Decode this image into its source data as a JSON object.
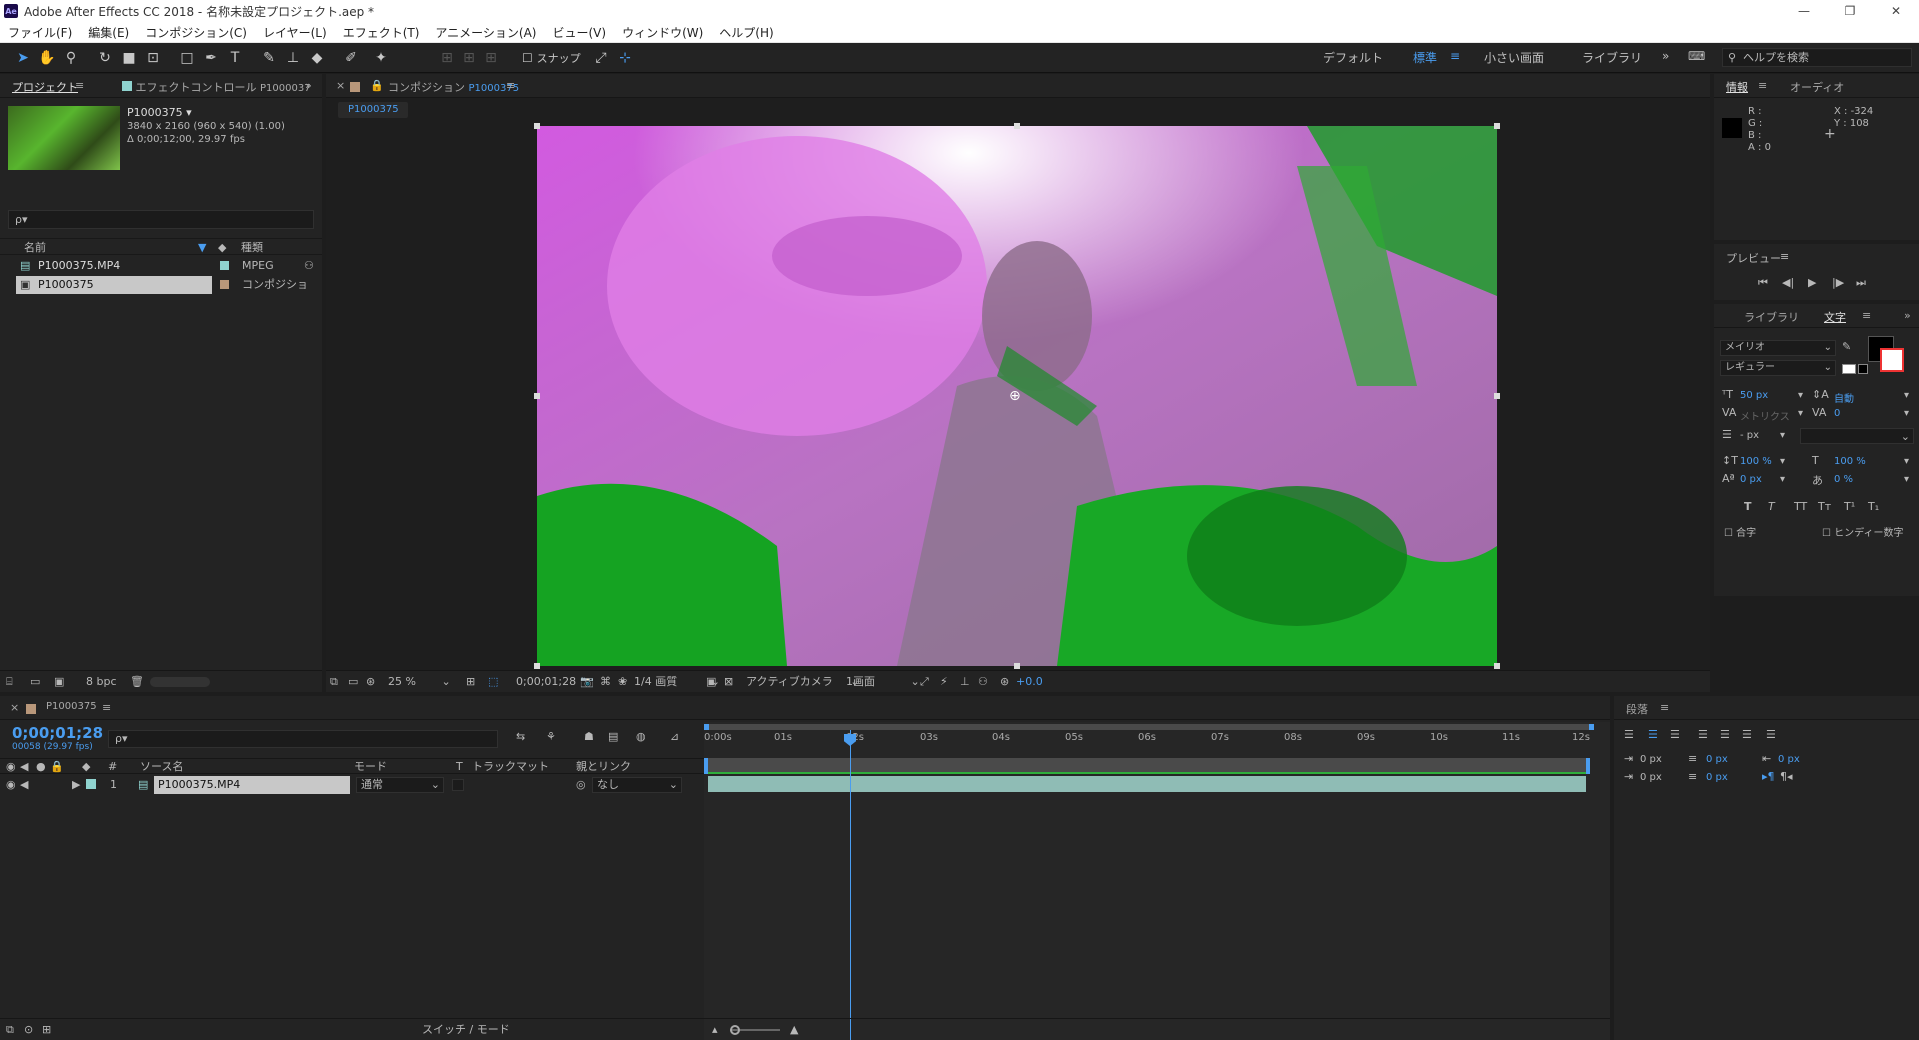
{
  "app": {
    "title": "Adobe After Effects CC 2018 - 名称未設定プロジェクト.aep *",
    "logo": "Ae",
    "window_buttons": [
      "—",
      "❐",
      "✕"
    ]
  },
  "menu": [
    "ファイル(F)",
    "編集(E)",
    "コンポジション(C)",
    "レイヤー(L)",
    "エフェクト(T)",
    "アニメーション(A)",
    "ビュー(V)",
    "ウィンドウ(W)",
    "ヘルプ(H)"
  ],
  "toolbar": {
    "snap_label": "スナップ",
    "workspaces": [
      "デフォルト",
      "標準",
      "小さい画面",
      "ライブラリ"
    ],
    "active_workspace": "標準",
    "help_placeholder": "ヘルプを検索"
  },
  "project": {
    "tab_project": "プロジェクト",
    "tab_effects": "エフェクトコントロール",
    "tab_effects_item": "P1000037",
    "item_name": "P1000375 ▾",
    "item_dims": "3840 x 2160  (960 x 540) (1.00)",
    "item_duration": "Δ 0;00;12;00, 29.97 fps",
    "search_placeholder": "ρ▾",
    "col_name": "名前",
    "col_type": "種類",
    "items": [
      {
        "name": "P1000375.MP4",
        "type": "MPEG",
        "color": "#8fd3cf"
      },
      {
        "name": "P1000375",
        "type": "コンポジショ",
        "color": "#b8977a"
      }
    ],
    "bpc": "8 bpc"
  },
  "comp": {
    "tab_label": "コンポジション",
    "tab_name": "P1000375",
    "subtab": "P1000375",
    "zoom": "25 %",
    "timecode": "0;00;01;28",
    "resolution": "1/4 画質",
    "camera": "アクティブカメラ",
    "view": "1画面",
    "exposure": "+0.0"
  },
  "info": {
    "tab_info": "情報",
    "tab_audio": "オーディオ",
    "r": "R :",
    "g": "G :",
    "b": "B :",
    "a": "A : 0",
    "x": "X : -324",
    "y": "Y : 108"
  },
  "preview": {
    "title": "プレビュー",
    "buttons": [
      "⏮",
      "◀|",
      "▶",
      "|▶",
      "⏭"
    ]
  },
  "character": {
    "tab_library": "ライブラリ",
    "tab_char": "文字",
    "font": "メイリオ",
    "style": "レギュラー",
    "size": "50 px",
    "leading": "自動",
    "kerning": "メトリクス",
    "tracking": "0",
    "stroke": "- px",
    "vscale": "100 %",
    "hscale": "100 %",
    "baseline": "0 px",
    "tsume": "0 %",
    "styles": [
      "T",
      "T",
      "TT",
      "Tт",
      "T¹",
      "T₁"
    ],
    "ligature": "合字",
    "hindi": "ヒンディー数字"
  },
  "paragraph": {
    "title": "段落",
    "indent_left": "0 px",
    "space_before": "0 px",
    "indent_right": "0 px",
    "first_indent": "0 px",
    "space_after": "0 px"
  },
  "timeline": {
    "tab": "P1000375",
    "timecode": "0;00;01;28",
    "frame_info": "00058 (29.97 fps)",
    "search_placeholder": "ρ▾",
    "col_num": "#",
    "col_source": "ソース名",
    "col_mode": "モード",
    "col_t": "T",
    "col_trkmat": "トラックマット",
    "col_parent": "親とリンク",
    "layer": {
      "num": "1",
      "name": "P1000375.MP4",
      "mode": "通常",
      "parent": "なし"
    },
    "ruler": [
      "0:00s",
      "01s",
      "02s",
      "03s",
      "04s",
      "05s",
      "06s",
      "07s",
      "08s",
      "09s",
      "10s",
      "11s",
      "12s"
    ],
    "switch_mode": "スイッチ / モード"
  },
  "colors": {
    "accent": "#4a9df0",
    "layer_bar": "#8fbcb5",
    "footage_label": "#8fd3cf",
    "comp_label": "#b8977a"
  }
}
